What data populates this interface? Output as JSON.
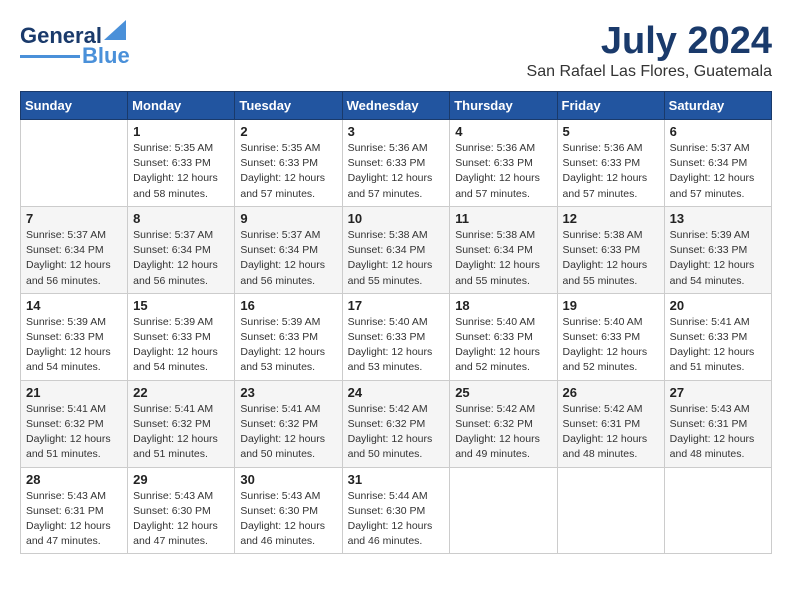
{
  "header": {
    "logo_text1": "General",
    "logo_text2": "Blue",
    "month": "July 2024",
    "location": "San Rafael Las Flores, Guatemala"
  },
  "weekdays": [
    "Sunday",
    "Monday",
    "Tuesday",
    "Wednesday",
    "Thursday",
    "Friday",
    "Saturday"
  ],
  "weeks": [
    [
      {
        "day": "",
        "info": ""
      },
      {
        "day": "1",
        "info": "Sunrise: 5:35 AM\nSunset: 6:33 PM\nDaylight: 12 hours\nand 58 minutes."
      },
      {
        "day": "2",
        "info": "Sunrise: 5:35 AM\nSunset: 6:33 PM\nDaylight: 12 hours\nand 57 minutes."
      },
      {
        "day": "3",
        "info": "Sunrise: 5:36 AM\nSunset: 6:33 PM\nDaylight: 12 hours\nand 57 minutes."
      },
      {
        "day": "4",
        "info": "Sunrise: 5:36 AM\nSunset: 6:33 PM\nDaylight: 12 hours\nand 57 minutes."
      },
      {
        "day": "5",
        "info": "Sunrise: 5:36 AM\nSunset: 6:33 PM\nDaylight: 12 hours\nand 57 minutes."
      },
      {
        "day": "6",
        "info": "Sunrise: 5:37 AM\nSunset: 6:34 PM\nDaylight: 12 hours\nand 57 minutes."
      }
    ],
    [
      {
        "day": "7",
        "info": "Sunrise: 5:37 AM\nSunset: 6:34 PM\nDaylight: 12 hours\nand 56 minutes."
      },
      {
        "day": "8",
        "info": "Sunrise: 5:37 AM\nSunset: 6:34 PM\nDaylight: 12 hours\nand 56 minutes."
      },
      {
        "day": "9",
        "info": "Sunrise: 5:37 AM\nSunset: 6:34 PM\nDaylight: 12 hours\nand 56 minutes."
      },
      {
        "day": "10",
        "info": "Sunrise: 5:38 AM\nSunset: 6:34 PM\nDaylight: 12 hours\nand 55 minutes."
      },
      {
        "day": "11",
        "info": "Sunrise: 5:38 AM\nSunset: 6:34 PM\nDaylight: 12 hours\nand 55 minutes."
      },
      {
        "day": "12",
        "info": "Sunrise: 5:38 AM\nSunset: 6:33 PM\nDaylight: 12 hours\nand 55 minutes."
      },
      {
        "day": "13",
        "info": "Sunrise: 5:39 AM\nSunset: 6:33 PM\nDaylight: 12 hours\nand 54 minutes."
      }
    ],
    [
      {
        "day": "14",
        "info": "Sunrise: 5:39 AM\nSunset: 6:33 PM\nDaylight: 12 hours\nand 54 minutes."
      },
      {
        "day": "15",
        "info": "Sunrise: 5:39 AM\nSunset: 6:33 PM\nDaylight: 12 hours\nand 54 minutes."
      },
      {
        "day": "16",
        "info": "Sunrise: 5:39 AM\nSunset: 6:33 PM\nDaylight: 12 hours\nand 53 minutes."
      },
      {
        "day": "17",
        "info": "Sunrise: 5:40 AM\nSunset: 6:33 PM\nDaylight: 12 hours\nand 53 minutes."
      },
      {
        "day": "18",
        "info": "Sunrise: 5:40 AM\nSunset: 6:33 PM\nDaylight: 12 hours\nand 52 minutes."
      },
      {
        "day": "19",
        "info": "Sunrise: 5:40 AM\nSunset: 6:33 PM\nDaylight: 12 hours\nand 52 minutes."
      },
      {
        "day": "20",
        "info": "Sunrise: 5:41 AM\nSunset: 6:33 PM\nDaylight: 12 hours\nand 51 minutes."
      }
    ],
    [
      {
        "day": "21",
        "info": "Sunrise: 5:41 AM\nSunset: 6:32 PM\nDaylight: 12 hours\nand 51 minutes."
      },
      {
        "day": "22",
        "info": "Sunrise: 5:41 AM\nSunset: 6:32 PM\nDaylight: 12 hours\nand 51 minutes."
      },
      {
        "day": "23",
        "info": "Sunrise: 5:41 AM\nSunset: 6:32 PM\nDaylight: 12 hours\nand 50 minutes."
      },
      {
        "day": "24",
        "info": "Sunrise: 5:42 AM\nSunset: 6:32 PM\nDaylight: 12 hours\nand 50 minutes."
      },
      {
        "day": "25",
        "info": "Sunrise: 5:42 AM\nSunset: 6:32 PM\nDaylight: 12 hours\nand 49 minutes."
      },
      {
        "day": "26",
        "info": "Sunrise: 5:42 AM\nSunset: 6:31 PM\nDaylight: 12 hours\nand 48 minutes."
      },
      {
        "day": "27",
        "info": "Sunrise: 5:43 AM\nSunset: 6:31 PM\nDaylight: 12 hours\nand 48 minutes."
      }
    ],
    [
      {
        "day": "28",
        "info": "Sunrise: 5:43 AM\nSunset: 6:31 PM\nDaylight: 12 hours\nand 47 minutes."
      },
      {
        "day": "29",
        "info": "Sunrise: 5:43 AM\nSunset: 6:30 PM\nDaylight: 12 hours\nand 47 minutes."
      },
      {
        "day": "30",
        "info": "Sunrise: 5:43 AM\nSunset: 6:30 PM\nDaylight: 12 hours\nand 46 minutes."
      },
      {
        "day": "31",
        "info": "Sunrise: 5:44 AM\nSunset: 6:30 PM\nDaylight: 12 hours\nand 46 minutes."
      },
      {
        "day": "",
        "info": ""
      },
      {
        "day": "",
        "info": ""
      },
      {
        "day": "",
        "info": ""
      }
    ]
  ]
}
